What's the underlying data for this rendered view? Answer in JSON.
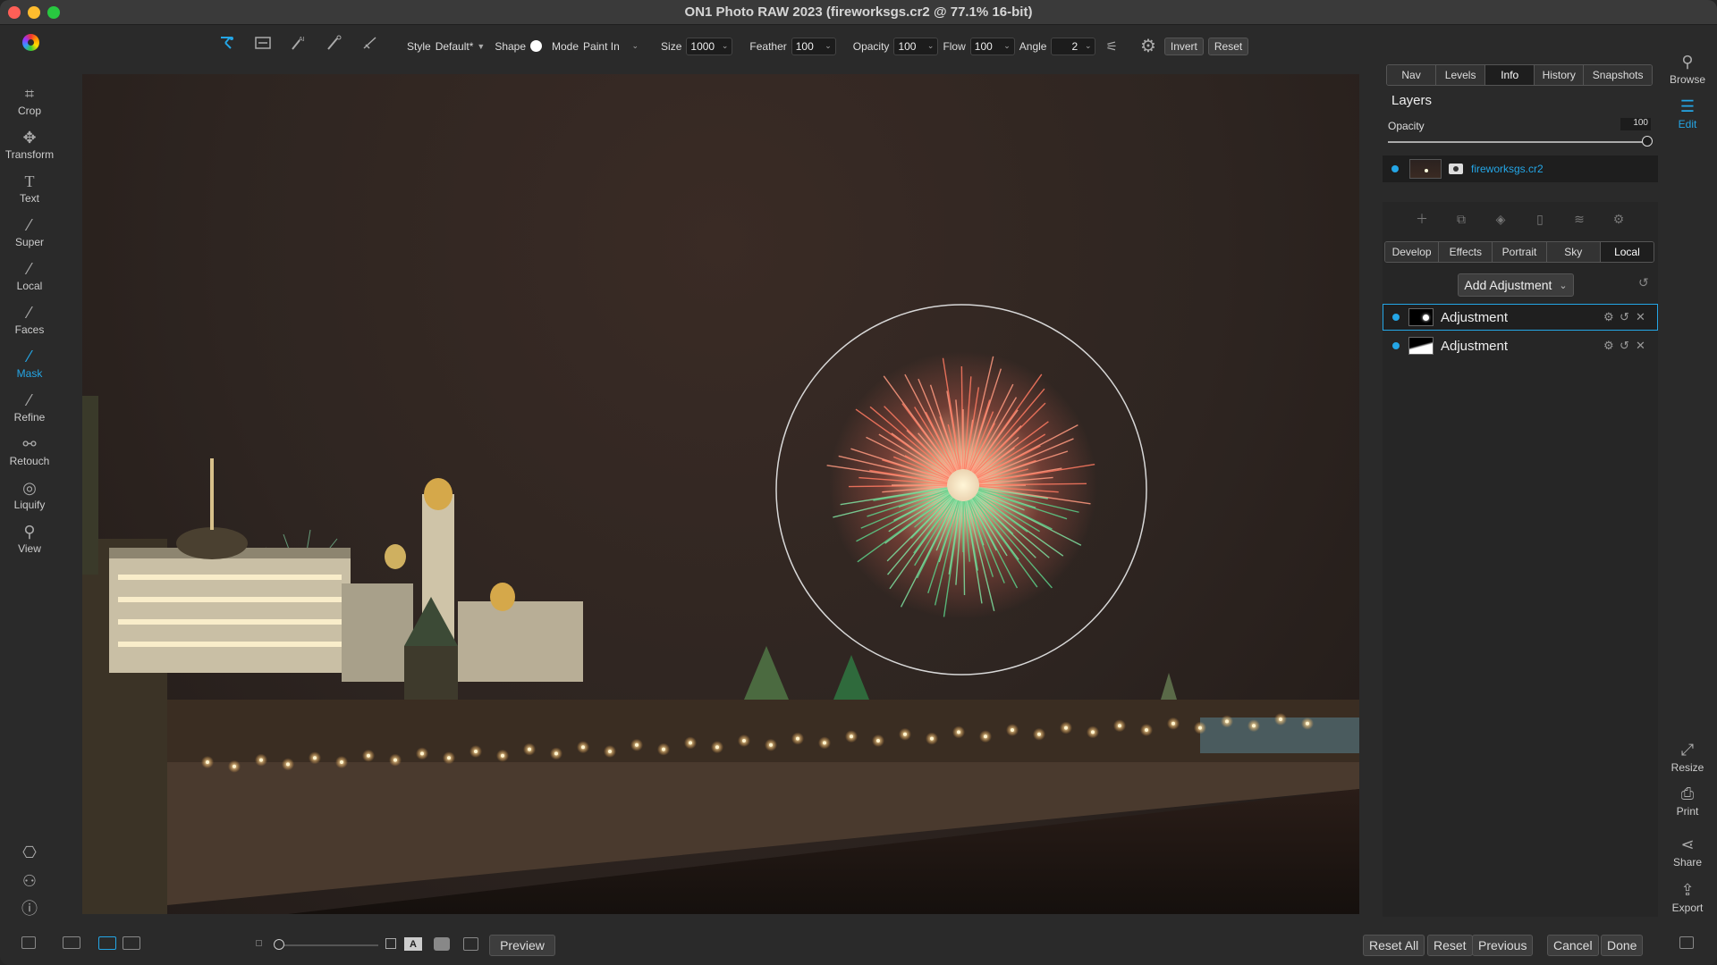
{
  "window": {
    "title": "ON1 Photo RAW 2023 (fireworksgs.cr2 @ 77.1% 16-bit)",
    "traffic_colors": [
      "#ff5f57",
      "#febc2e",
      "#28c840"
    ]
  },
  "toolbar": {
    "style_label": "Style",
    "style_value": "Default*",
    "shape_label": "Shape",
    "mode_label": "Mode",
    "mode_value": "Paint In",
    "size_label": "Size",
    "size_value": "1000",
    "feather_label": "Feather",
    "feather_value": "100",
    "opacity_label": "Opacity",
    "opacity_value": "100",
    "flow_label": "Flow",
    "flow_value": "100",
    "angle_label": "Angle",
    "angle_value": "2",
    "invert_label": "Invert",
    "reset_label": "Reset"
  },
  "left_tools": [
    {
      "label": "Crop",
      "icon": "crop-icon"
    },
    {
      "label": "Transform",
      "icon": "transform-icon"
    },
    {
      "label": "Text",
      "icon": "text-icon"
    },
    {
      "label": "Super",
      "icon": "super-brush-icon"
    },
    {
      "label": "Local",
      "icon": "local-brush-icon"
    },
    {
      "label": "Faces",
      "icon": "faces-icon"
    },
    {
      "label": "Mask",
      "icon": "mask-brush-icon"
    },
    {
      "label": "Refine",
      "icon": "refine-brush-icon"
    },
    {
      "label": "Retouch",
      "icon": "retouch-icon"
    },
    {
      "label": "Liquify",
      "icon": "liquify-icon"
    },
    {
      "label": "View",
      "icon": "view-hand-icon"
    }
  ],
  "panel": {
    "top_tabs": [
      "Nav",
      "Levels",
      "Info",
      "History",
      "Snapshots"
    ],
    "active_top_tab": "Info",
    "layers_title": "Layers",
    "opacity_label": "Opacity",
    "opacity_value": "100",
    "layer_name": "fireworksgs.cr2",
    "edit_tabs": [
      "Develop",
      "Effects",
      "Portrait",
      "Sky",
      "Local"
    ],
    "active_edit_tab": "Local",
    "add_adjustment_label": "Add Adjustment",
    "adjustments": [
      {
        "label": "Adjustment",
        "selected": true
      },
      {
        "label": "Adjustment",
        "selected": false
      }
    ]
  },
  "right_rail": {
    "browse_label": "Browse",
    "edit_label": "Edit",
    "resize_label": "Resize",
    "print_label": "Print",
    "share_label": "Share",
    "export_label": "Export"
  },
  "bottom": {
    "preview_label": "Preview",
    "reset_all_label": "Reset All",
    "reset_label": "Reset",
    "previous_label": "Previous",
    "cancel_label": "Cancel",
    "done_label": "Done"
  },
  "colors": {
    "accent": "#24a6e6"
  }
}
